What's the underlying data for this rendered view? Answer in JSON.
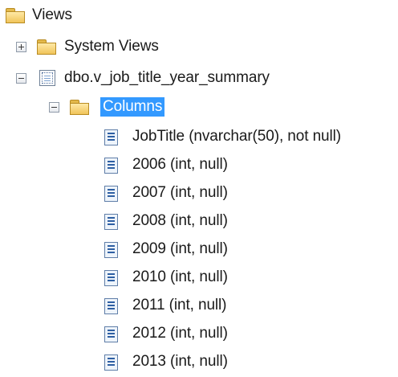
{
  "tree": {
    "views_folder": {
      "label": "Views",
      "icon": "folder-icon"
    },
    "system_views": {
      "label": "System Views",
      "icon": "folder-icon",
      "expanded": false
    },
    "view": {
      "label": "dbo.v_job_title_year_summary",
      "icon": "view-icon",
      "expanded": true
    },
    "columns_folder": {
      "label": "Columns",
      "icon": "folder-icon",
      "expanded": true,
      "selected": true
    },
    "columns": [
      {
        "label": "JobTitle (nvarchar(50), not null)",
        "icon": "column-icon"
      },
      {
        "label": "2006 (int, null)",
        "icon": "column-icon"
      },
      {
        "label": "2007 (int, null)",
        "icon": "column-icon"
      },
      {
        "label": "2008 (int, null)",
        "icon": "column-icon"
      },
      {
        "label": "2009 (int, null)",
        "icon": "column-icon"
      },
      {
        "label": "2010 (int, null)",
        "icon": "column-icon"
      },
      {
        "label": "2011 (int, null)",
        "icon": "column-icon"
      },
      {
        "label": "2012 (int, null)",
        "icon": "column-icon"
      },
      {
        "label": "2013 (int, null)",
        "icon": "column-icon"
      }
    ]
  },
  "colors": {
    "selection": "#3399ff",
    "folder": "#f0c45a",
    "column_icon": "#2e5fa3"
  }
}
